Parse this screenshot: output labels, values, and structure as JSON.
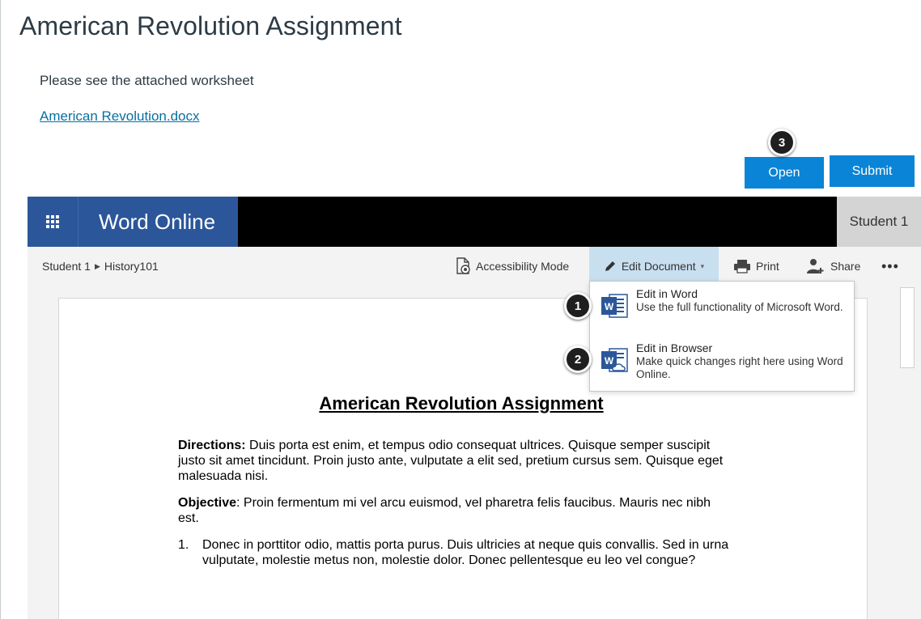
{
  "page": {
    "title": "American Revolution Assignment",
    "description": "Please see the attached worksheet",
    "file_link": "American Revolution.docx"
  },
  "actions": {
    "open_label": "Open",
    "submit_label": "Submit"
  },
  "callouts": [
    "1",
    "2",
    "3"
  ],
  "word_online": {
    "brand": "Word Online",
    "user": "Student 1",
    "breadcrumb": [
      "Student 1",
      "History101"
    ],
    "toolbar": {
      "accessibility": "Accessibility Mode",
      "edit_document": "Edit Document",
      "print": "Print",
      "share": "Share",
      "more": "•••"
    },
    "edit_menu": [
      {
        "title": "Edit in Word",
        "subtitle": "Use the full functionality of Microsoft Word.",
        "icon": "word-icon"
      },
      {
        "title": "Edit in Browser",
        "subtitle": "Make quick changes right here using Word Online.",
        "icon": "word-online-icon"
      }
    ]
  },
  "document": {
    "title": "American Revolution Assignment",
    "directions_label": "Directions:",
    "directions_text": " Duis porta est enim, et tempus odio consequat ultrices. Quisque semper suscipit justo sit amet tincidunt. Proin justo ante, vulputate a elit sed, pretium cursus sem. Quisque eget malesuada nisi.",
    "objective_label": "Objective",
    "objective_text": ": Proin fermentum mi vel arcu euismod, vel pharetra felis faucibus. Mauris nec nibh est.",
    "list": [
      {
        "num": "1.",
        "text": "Donec in porttitor odio, mattis porta purus. Duis ultricies at neque quis convallis. Sed in urna vulputate, molestie metus non, molestie dolor. Donec pellentesque eu leo vel congue?"
      }
    ]
  },
  "colors": {
    "word_blue": "#2b579a",
    "canvas_blue": "#0a84d6",
    "link": "#0770a3",
    "edit_highlight": "#c8dff0"
  }
}
